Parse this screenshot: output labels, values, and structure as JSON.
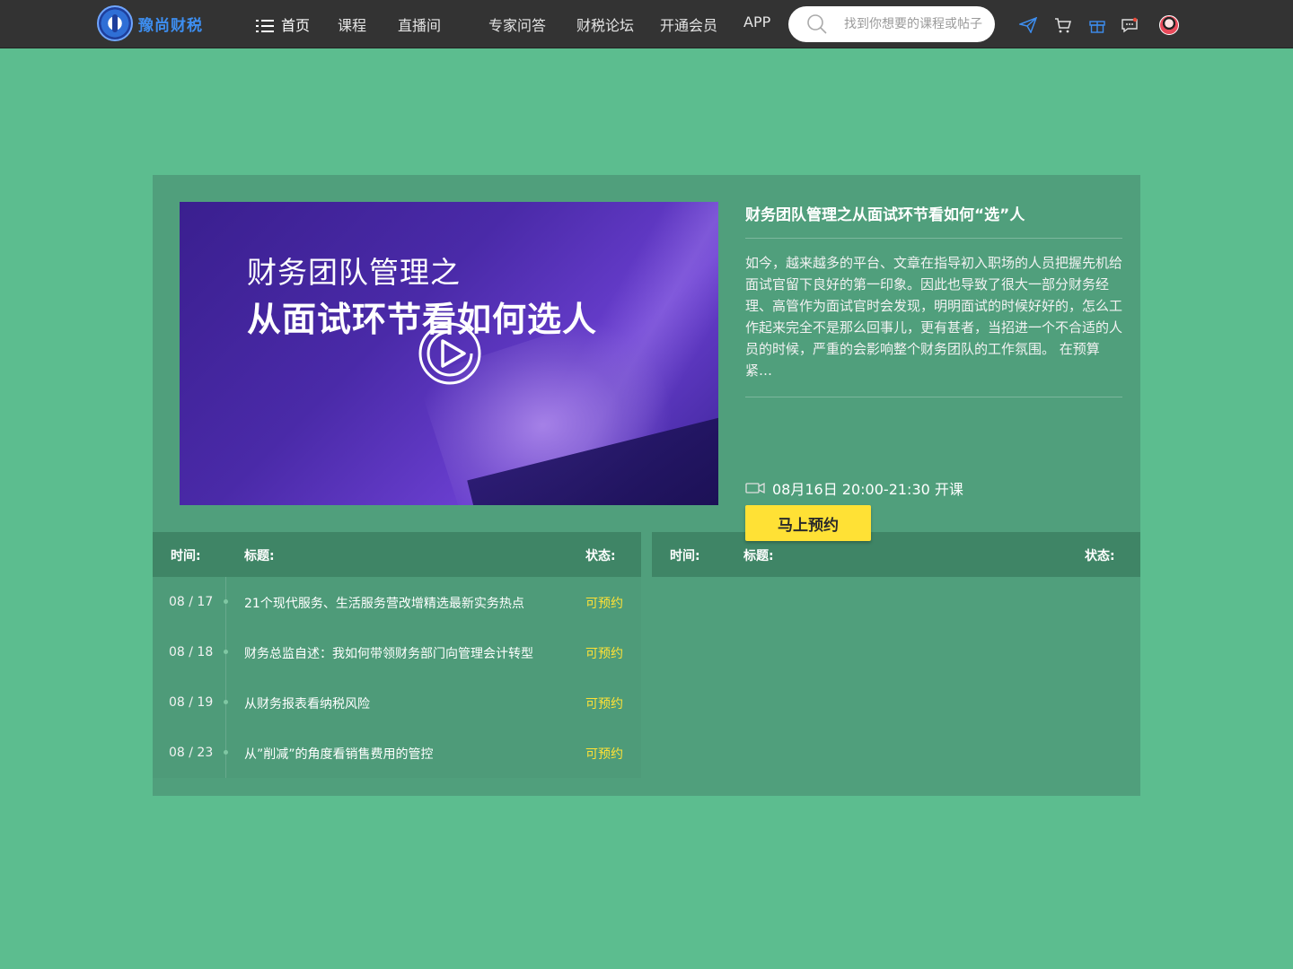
{
  "header": {
    "logo_text": "豫尚财税",
    "nav": [
      {
        "label": "首页"
      },
      {
        "label": "课程"
      },
      {
        "label": "直播间"
      },
      {
        "label": "专家问答"
      },
      {
        "label": "财税论坛"
      },
      {
        "label": "开通会员"
      },
      {
        "label": "APP"
      }
    ],
    "search_placeholder": "找到你想要的课程或帖子",
    "icons": [
      "send-icon",
      "cart-icon",
      "gift-icon",
      "message-icon"
    ]
  },
  "course": {
    "video_line1": "财务团队管理之",
    "video_line2": "从面试环节看如何选人",
    "title": "财务团队管理之从面试环节看如何“选”人",
    "description": "如今，越来越多的平台、文章在指导初入职场的人员把握先机给面试官留下良好的第一印象。因此也导致了很大一部分财务经理、高管作为面试官时会发现，明明面试的时候好好的，怎么工作起来完全不是那么回事儿，更有甚者，当招进一个不合适的人员的时候，严重的会影响整个财务团队的工作氛围。 在预算紧…",
    "schedule": "08月16日 20:00-21:30 开课",
    "reserve_label": "马上预约"
  },
  "list_left": {
    "head_time": "时间:",
    "head_title": "标题:",
    "head_status": "状态:",
    "rows": [
      {
        "date": "08 / 17",
        "title": "21个现代服务、生活服务营改增精选最新实务热点",
        "status": "可预约"
      },
      {
        "date": "08 / 18",
        "title": "财务总监自述：我如何带领财务部门向管理会计转型",
        "status": "可预约"
      },
      {
        "date": "08 / 19",
        "title": "从财务报表看纳税风险",
        "status": "可预约"
      },
      {
        "date": "08 / 23",
        "title": "从”削减”的角度看销售费用的管控",
        "status": "可预约"
      }
    ]
  },
  "list_right": {
    "head_time": "时间:",
    "head_title": "标题:",
    "head_status": "状态:"
  },
  "colors": {
    "page_bg": "#5cbd8f",
    "panel_bg": "#509f7c",
    "header_bg": "#333333",
    "accent_yellow": "#ffe135",
    "list_head_bg": "#3f8566"
  }
}
